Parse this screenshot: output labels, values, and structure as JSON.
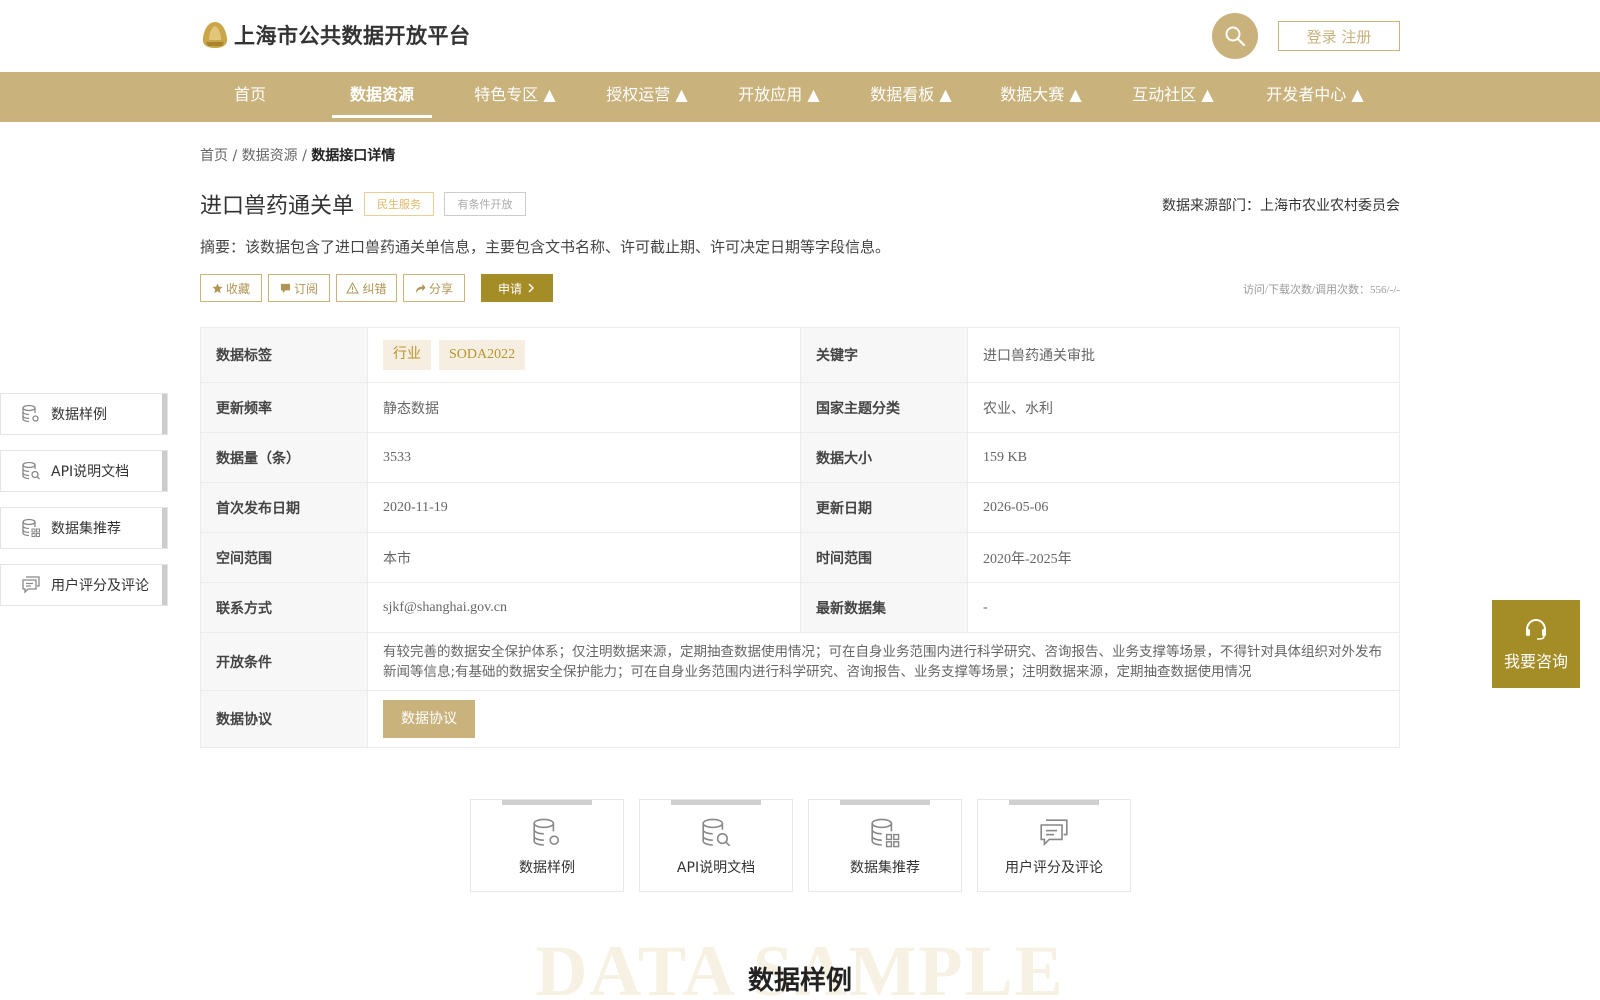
{
  "header": {
    "site_title": "上海市公共数据开放平台",
    "login_label": "登录 注册"
  },
  "nav": {
    "items": [
      {
        "label": "首页"
      },
      {
        "label": "数据资源"
      },
      {
        "label": "特色专区 ▲"
      },
      {
        "label": "授权运营 ▲"
      },
      {
        "label": "开放应用 ▲"
      },
      {
        "label": "数据看板 ▲"
      },
      {
        "label": "数据大赛 ▲"
      },
      {
        "label": "互动社区 ▲"
      },
      {
        "label": "开发者中心 ▲"
      }
    ],
    "active_index": 1
  },
  "breadcrumb": {
    "home": "首页",
    "sep1": " / ",
    "resource": "数据资源",
    "sep2": " / ",
    "current": "数据接口详情"
  },
  "detail": {
    "title": "进口兽药通关单",
    "tag_service": "民生服务",
    "tag_open": "有条件开放",
    "source": "数据来源部门：上海市农业农村委员会",
    "summary": "摘要：该数据包含了进口兽药通关单信息，主要包含文书名称、许可截止期、许可决定日期等字段信息。",
    "counts": "访问/下载次数/调用次数：556/-/-"
  },
  "actions": {
    "favorite": "收藏",
    "subscribe": "订阅",
    "report": "纠错",
    "share": "分享",
    "apply": "申请"
  },
  "table": {
    "label_tags": "数据标签",
    "tags": [
      "行业",
      "SODA2022"
    ],
    "label_keyword": "关键字",
    "keyword": "进口兽药通关审批",
    "label_freq": "更新频率",
    "freq": "静态数据",
    "label_theme": "国家主题分类",
    "theme": "农业、水利",
    "label_count": "数据量（条）",
    "count": "3533",
    "label_size": "数据大小",
    "size": "159 KB",
    "label_first": "首次发布日期",
    "first": "2020-11-19",
    "label_update": "更新日期",
    "update": "2026-05-06",
    "label_space": "空间范围",
    "space": "本市",
    "label_time": "时间范围",
    "time": "2020年-2025年",
    "label_contact": "联系方式",
    "contact": "sjkf@shanghai.gov.cn",
    "label_latest": "最新数据集",
    "latest": "-",
    "label_cond": "开放条件",
    "cond": "有较完善的数据安全保护体系；仅注明数据来源，定期抽查数据使用情况；可在自身业务范围内进行科学研究、咨询报告、业务支撑等场景，不得针对具体组织对外发布新闻等信息;有基础的数据安全保护能力；可在自身业务范围内进行科学研究、咨询报告、业务支撑等场景；注明数据来源，定期抽查数据使用情况",
    "label_agreement": "数据协议",
    "agreement_btn": "数据协议"
  },
  "side_nav": [
    {
      "label": "数据样例",
      "icon": "database-gear-icon"
    },
    {
      "label": "API说明文档",
      "icon": "database-search-icon"
    },
    {
      "label": "数据集推荐",
      "icon": "database-grid-icon"
    },
    {
      "label": "用户评分及评论",
      "icon": "comment-icon"
    }
  ],
  "consult": {
    "label": "我要咨询"
  },
  "cards": [
    {
      "label": "数据样例"
    },
    {
      "label": "API说明文档"
    },
    {
      "label": "数据集推荐"
    },
    {
      "label": "用户评分及评论"
    }
  ],
  "section": {
    "bg_text": "DATA SAMPLE",
    "title": "数据样例"
  },
  "colors": {
    "brand": "#c9b27c",
    "accent": "#a48c27"
  }
}
